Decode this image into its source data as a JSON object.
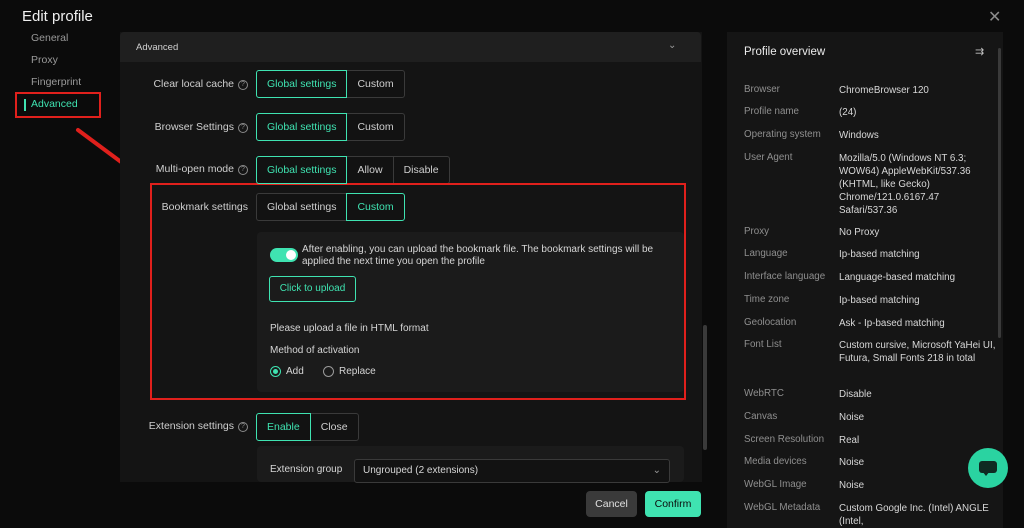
{
  "dialog": {
    "title": "Edit profile",
    "close_glyph": "✕"
  },
  "nav": {
    "items": [
      {
        "label": "General"
      },
      {
        "label": "Proxy"
      },
      {
        "label": "Fingerprint"
      },
      {
        "label": "Advanced"
      }
    ]
  },
  "advanced": {
    "header": "Advanced",
    "chevron": "⌄",
    "rows": {
      "clear_cache": {
        "label": "Clear local cache",
        "options": [
          "Global settings",
          "Custom"
        ]
      },
      "browser_settings": {
        "label": "Browser Settings",
        "options": [
          "Global settings",
          "Custom"
        ]
      },
      "multi_open": {
        "label": "Multi-open mode",
        "options": [
          "Global settings",
          "Allow",
          "Disable"
        ]
      },
      "bookmark": {
        "label": "Bookmark settings",
        "options": [
          "Global settings",
          "Custom"
        ]
      },
      "extension": {
        "label": "Extension settings",
        "options": [
          "Enable",
          "Close"
        ]
      }
    },
    "bookmark_panel": {
      "toggle_text": "After enabling, you can upload the bookmark file. The bookmark settings will be applied the next time you open the profile",
      "upload_label": "Click to upload",
      "format_note": "Please upload a file in HTML format",
      "activation_label": "Method of activation",
      "option_add": "Add",
      "option_replace": "Replace"
    },
    "extension_panel": {
      "group_label": "Extension group",
      "group_value": "Ungrouped (2 extensions)"
    }
  },
  "footer": {
    "cancel": "Cancel",
    "confirm": "Confirm"
  },
  "overview": {
    "title": "Profile overview",
    "icon": "⇉",
    "rows": [
      {
        "k": "Browser",
        "v": "ChromeBrowser 120"
      },
      {
        "k": "Profile name",
        "v": "(24)"
      },
      {
        "k": "Operating system",
        "v": "Windows"
      },
      {
        "k": "User Agent",
        "v": "Mozilla/5.0 (Windows NT 6.3; WOW64) AppleWebKit/537.36 (KHTML, like Gecko) Chrome/121.0.6167.47 Safari/537.36"
      },
      {
        "k": "Proxy",
        "v": "No Proxy"
      },
      {
        "k": "Language",
        "v": "Ip-based matching"
      },
      {
        "k": "Interface language",
        "v": "Language-based matching"
      },
      {
        "k": "Time zone",
        "v": "Ip-based matching"
      },
      {
        "k": "Geolocation",
        "v": "Ask - Ip-based matching"
      },
      {
        "k": "Font List",
        "v": "Custom cursive, Microsoft YaHei UI, Futura, Small Fonts 218 in total"
      },
      {
        "k": "WebRTC",
        "v": "Disable"
      },
      {
        "k": "Canvas",
        "v": "Noise"
      },
      {
        "k": "Screen Resolution",
        "v": "Real"
      },
      {
        "k": "Media devices",
        "v": "Noise"
      },
      {
        "k": "WebGL Image",
        "v": "Noise"
      },
      {
        "k": "WebGL Metadata",
        "v": "Custom Google Inc. (Intel) ANGLE (Intel,"
      }
    ]
  },
  "colors": {
    "accent": "#3fe3b1",
    "highlight": "#e0201c",
    "bg": "#0b0b0b"
  }
}
